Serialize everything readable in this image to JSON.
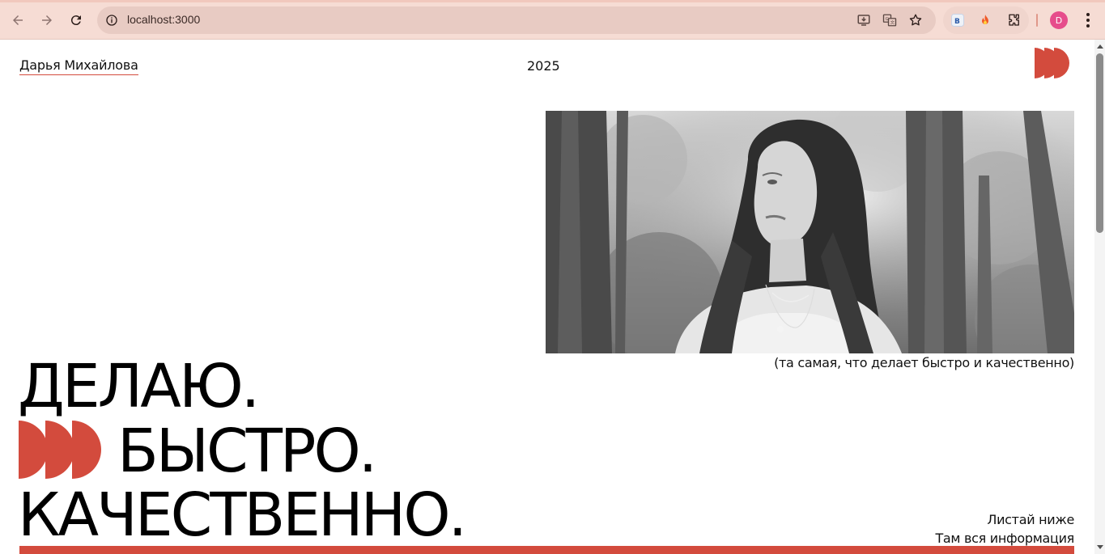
{
  "browser": {
    "url": "localhost:3000",
    "profile_initial": "D",
    "accent": "#f6dcd4",
    "icons": {
      "back": "back-arrow-icon",
      "forward": "forward-arrow-icon",
      "reload": "reload-icon",
      "site_info": "site-info-icon",
      "install": "install-app-icon",
      "translate": "translate-icon",
      "bookmark": "bookmark-star-icon",
      "extension_1": "vk-extension-icon",
      "extension_2": "flame-extension-icon",
      "extensions": "puzzle-extensions-icon",
      "menu": "kebab-menu-icon"
    }
  },
  "header": {
    "owner_name": "Дарья Михайлова",
    "year": "2025"
  },
  "hero": {
    "caption": "(та самая, что делает быстро и качественно)",
    "line1": "ДЕЛАЮ.",
    "line2": "БЫСТРО.",
    "line3": "КАЧЕСТВЕННО.",
    "scroll_hint_1": "Листай ниже",
    "scroll_hint_2": "Там вся информация"
  },
  "colors": {
    "brand_red": "#d34b3d",
    "text": "#111111",
    "background": "#ffffff"
  }
}
